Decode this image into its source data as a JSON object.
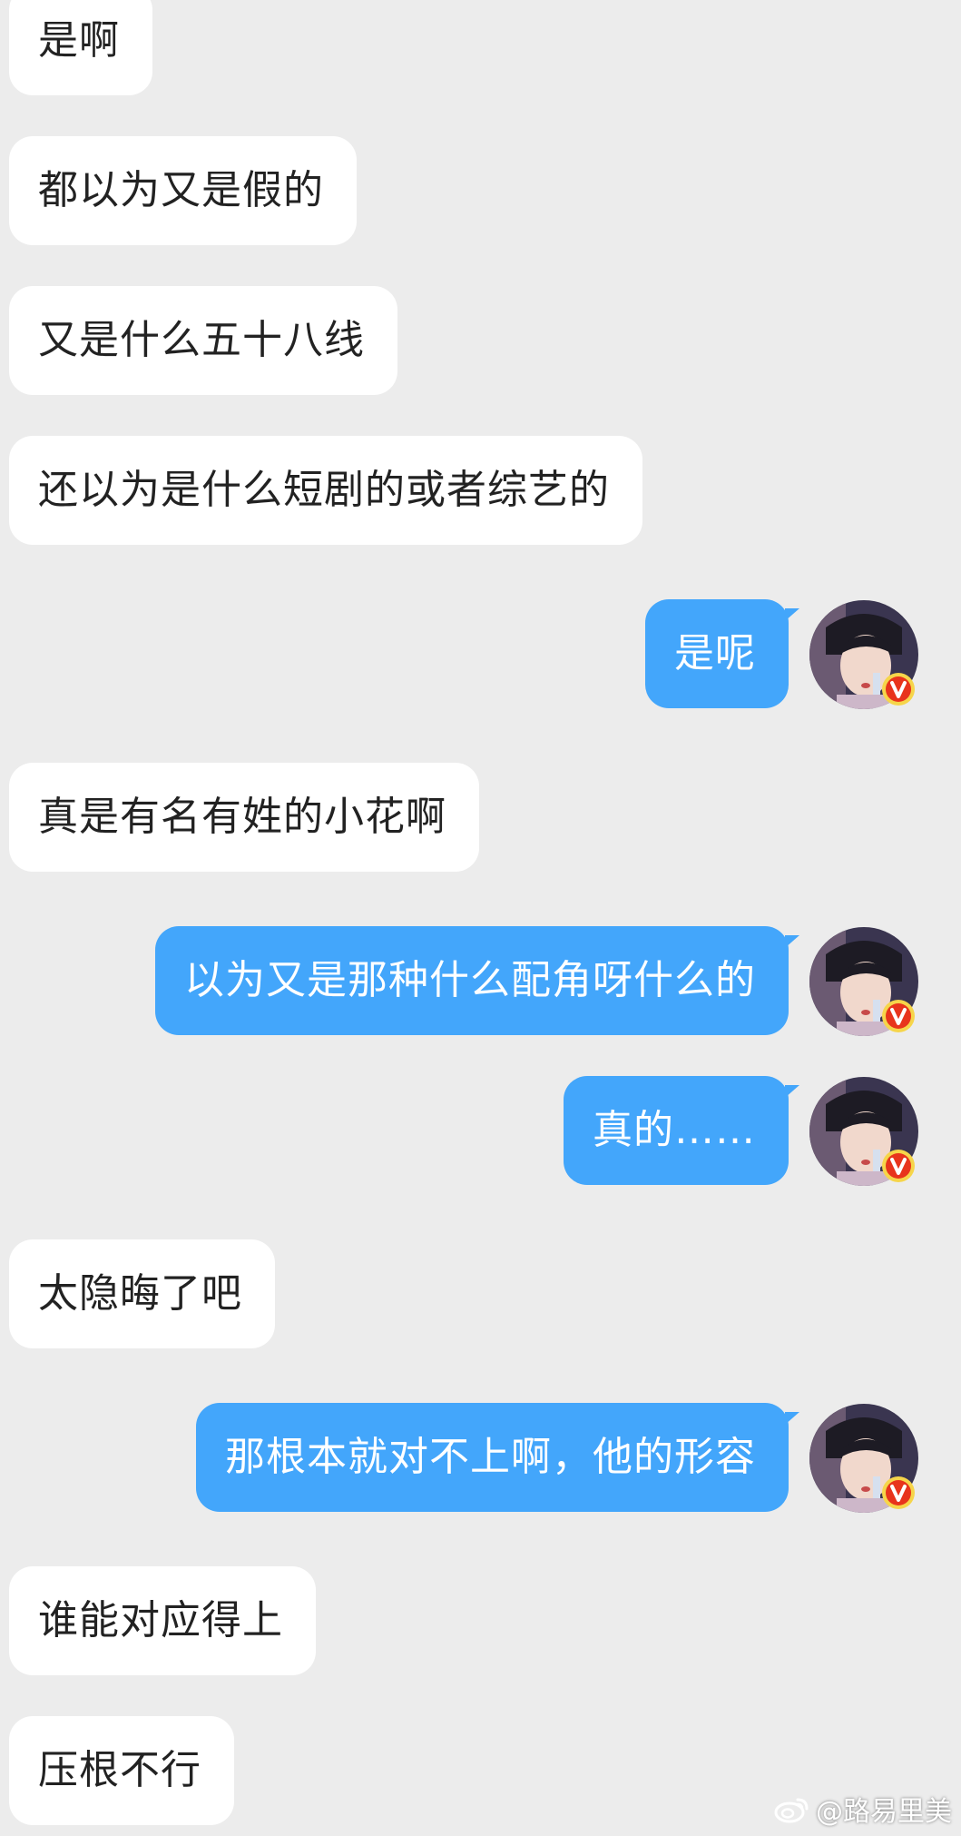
{
  "colors": {
    "background": "#ececec",
    "incoming_bubble": "#ffffff",
    "outgoing_bubble": "#43a6fb",
    "verified_badge": "#e8341c"
  },
  "avatar_icon": "portrait-avatar-icon",
  "verified_icon": "verified-v-badge-icon",
  "messages": [
    {
      "side": "in",
      "text": "是啊"
    },
    {
      "side": "in",
      "text": "都以为又是假的"
    },
    {
      "side": "in",
      "text": "又是什么五十八线"
    },
    {
      "side": "in",
      "text": "还以为是什么短剧的或者综艺的"
    },
    {
      "side": "out",
      "text": "是呢"
    },
    {
      "side": "in",
      "text": "真是有名有姓的小花啊"
    },
    {
      "side": "out",
      "text": "以为又是那种什么配角呀什么的"
    },
    {
      "side": "out",
      "text": "真的……"
    },
    {
      "side": "in",
      "text": "太隐晦了吧"
    },
    {
      "side": "out",
      "text": "那根本就对不上啊，他的形容"
    },
    {
      "side": "in",
      "text": "谁能对应得上"
    },
    {
      "side": "in",
      "text": "压根不行"
    }
  ],
  "watermark": {
    "icon": "weibo-logo-icon",
    "text": "@路易里美"
  }
}
